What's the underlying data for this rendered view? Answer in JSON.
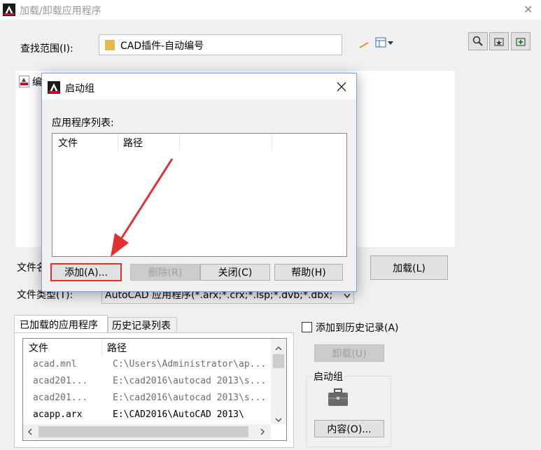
{
  "window": {
    "title": "加载/卸载应用程序",
    "close_glyph": "✕"
  },
  "search": {
    "label": "查找范围(I):",
    "path": "CAD插件-自动编号"
  },
  "file_list": {
    "item_partial": "编"
  },
  "file_name": {
    "label_partial": "文件名"
  },
  "file_type": {
    "label": "文件类型(T):",
    "value": "AutoCAD 应用程序(*.arx;*.crx;*.lsp;*.dvb;*.dbx;"
  },
  "load_button": "加载(L)",
  "tabs": [
    "已加载的应用程序",
    "历史记录列表"
  ],
  "loaded_list": {
    "headers": [
      "文件",
      "路径"
    ],
    "rows": [
      {
        "file": "acad.mnl",
        "path": "C:\\Users\\Administrator\\ap...",
        "dim": true
      },
      {
        "file": "acad201...",
        "path": "E:\\cad2016\\autocad 2013\\s...",
        "dim": true
      },
      {
        "file": "acad201...",
        "path": "E:\\cad2016\\autocad 2013\\s...",
        "dim": true
      },
      {
        "file": "acapp.arx",
        "path": "E:\\CAD2016\\AutoCAD 2013\\",
        "dim": false
      }
    ]
  },
  "history_checkbox": "添加到历史记录(A)",
  "unload_button": "卸载(U)",
  "startup_group": {
    "label": "启动组",
    "content_button": "内容(O)..."
  },
  "dialog": {
    "title": "启动组",
    "list_label": "应用程序列表:",
    "headers": [
      "文件",
      "路径"
    ],
    "buttons": {
      "add": "添加(A)...",
      "delete": "删除(R)",
      "close": "关闭(C)",
      "help": "帮助(H)"
    }
  },
  "colors": {
    "accent_red": "#e03030",
    "window_bg": "#f0f0f0",
    "dialog_border": "#7aa7d8"
  }
}
